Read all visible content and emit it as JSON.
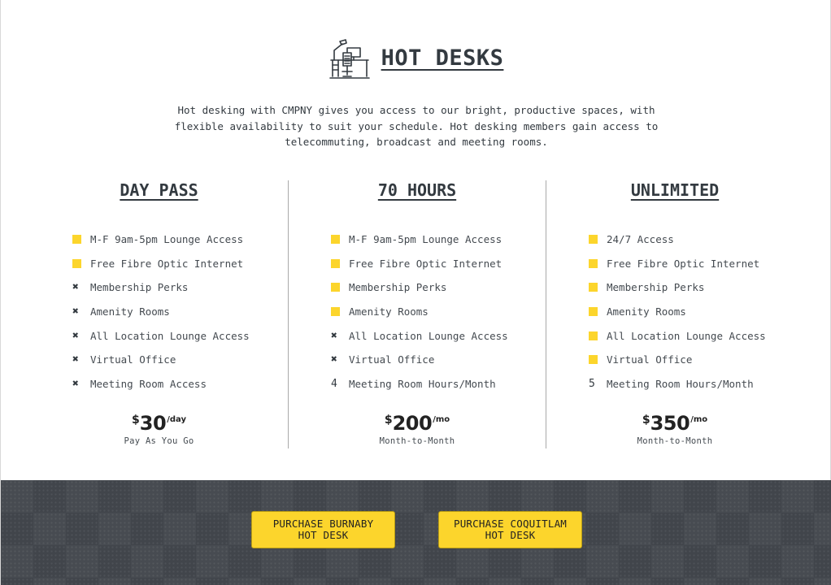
{
  "header": {
    "title": "HOT DESKS",
    "icon": "desk-workstation-icon",
    "intro": "Hot desking with CMPNY gives you access to our bright, productive spaces, with flexible availability to suit your schedule. Hot desking members gain access to telecommuting, broadcast and meeting rooms."
  },
  "colors": {
    "accent": "#fcd52c",
    "text": "#333a40",
    "footer_bg": "#474b51"
  },
  "plans": [
    {
      "name": "DAY PASS",
      "features": [
        {
          "marker": "square",
          "label": "M-F 9am-5pm Lounge Access"
        },
        {
          "marker": "square",
          "label": "Free Fibre Optic Internet"
        },
        {
          "marker": "x",
          "label": "Membership Perks"
        },
        {
          "marker": "x",
          "label": "Amenity Rooms"
        },
        {
          "marker": "x",
          "label": "All Location Lounge Access"
        },
        {
          "marker": "x",
          "label": "Virtual Office"
        },
        {
          "marker": "x",
          "label": "Meeting Room Access"
        }
      ],
      "price": {
        "currency": "$",
        "amount": "30",
        "per": "/day",
        "terms": "Pay As You Go"
      }
    },
    {
      "name": "70 HOURS",
      "features": [
        {
          "marker": "square",
          "label": "M-F 9am-5pm Lounge Access"
        },
        {
          "marker": "square",
          "label": "Free Fibre Optic Internet"
        },
        {
          "marker": "square",
          "label": "Membership Perks"
        },
        {
          "marker": "square",
          "label": "Amenity Rooms"
        },
        {
          "marker": "x",
          "label": "All Location Lounge Access"
        },
        {
          "marker": "x",
          "label": "Virtual Office"
        },
        {
          "marker": "number",
          "number": "4",
          "label": "Meeting Room Hours/Month"
        }
      ],
      "price": {
        "currency": "$",
        "amount": "200",
        "per": "/mo",
        "terms": "Month-to-Month"
      }
    },
    {
      "name": "UNLIMITED",
      "features": [
        {
          "marker": "square",
          "label": "24/7 Access"
        },
        {
          "marker": "square",
          "label": "Free Fibre Optic Internet"
        },
        {
          "marker": "square",
          "label": "Membership Perks"
        },
        {
          "marker": "square",
          "label": "Amenity Rooms"
        },
        {
          "marker": "square",
          "label": "All Location Lounge Access"
        },
        {
          "marker": "square",
          "label": "Virtual Office"
        },
        {
          "marker": "number",
          "number": "5",
          "label": "Meeting Room Hours/Month"
        }
      ],
      "price": {
        "currency": "$",
        "amount": "350",
        "per": "/mo",
        "terms": "Month-to-Month"
      }
    }
  ],
  "footer": {
    "buttons": [
      {
        "line1": "PURCHASE BURNABY",
        "line2": "HOT DESK"
      },
      {
        "line1": "PURCHASE COQUITLAM",
        "line2": "HOT DESK"
      }
    ]
  }
}
